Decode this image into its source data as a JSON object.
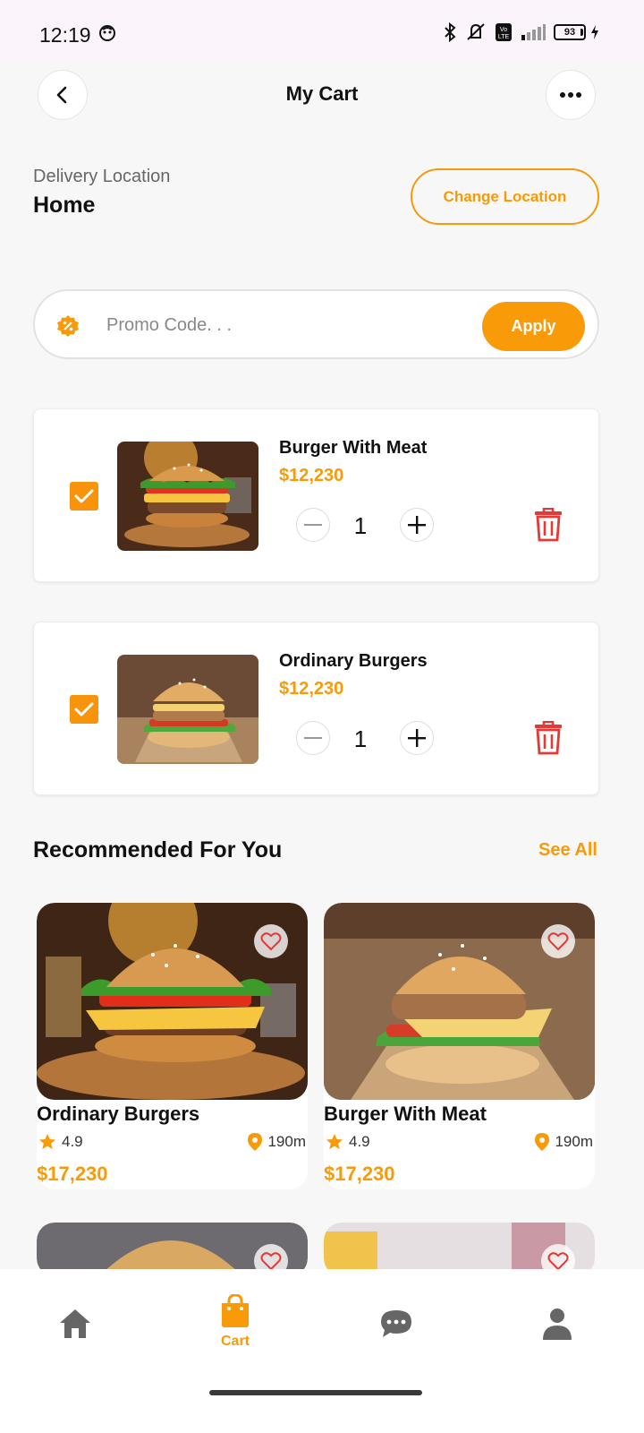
{
  "status": {
    "time": "12:19",
    "battery": "93"
  },
  "header": {
    "title": "My Cart"
  },
  "location": {
    "label": "Delivery Location",
    "value": "Home",
    "change_label": "Change Location"
  },
  "promo": {
    "placeholder": "Promo Code. . .",
    "apply_label": "Apply"
  },
  "cart": {
    "items": [
      {
        "name": "Burger With Meat",
        "price": "$12,230",
        "qty": "1",
        "checked": true
      },
      {
        "name": "Ordinary Burgers",
        "price": "$12,230",
        "qty": "1",
        "checked": true
      }
    ]
  },
  "recommended": {
    "title": "Recommended For You",
    "see_all": "See All",
    "items": [
      {
        "name": "Ordinary Burgers",
        "rating": "4.9",
        "distance": "190m",
        "price": "$17,230"
      },
      {
        "name": "Burger With Meat",
        "rating": "4.9",
        "distance": "190m",
        "price": "$17,230"
      }
    ]
  },
  "nav": {
    "items": [
      {
        "icon": "home-icon"
      },
      {
        "icon": "bag-icon",
        "label": "Cart",
        "active": true
      },
      {
        "icon": "chat-icon"
      },
      {
        "icon": "profile-icon"
      }
    ]
  },
  "colors": {
    "accent": "#f99a09",
    "delete": "#e53935"
  }
}
